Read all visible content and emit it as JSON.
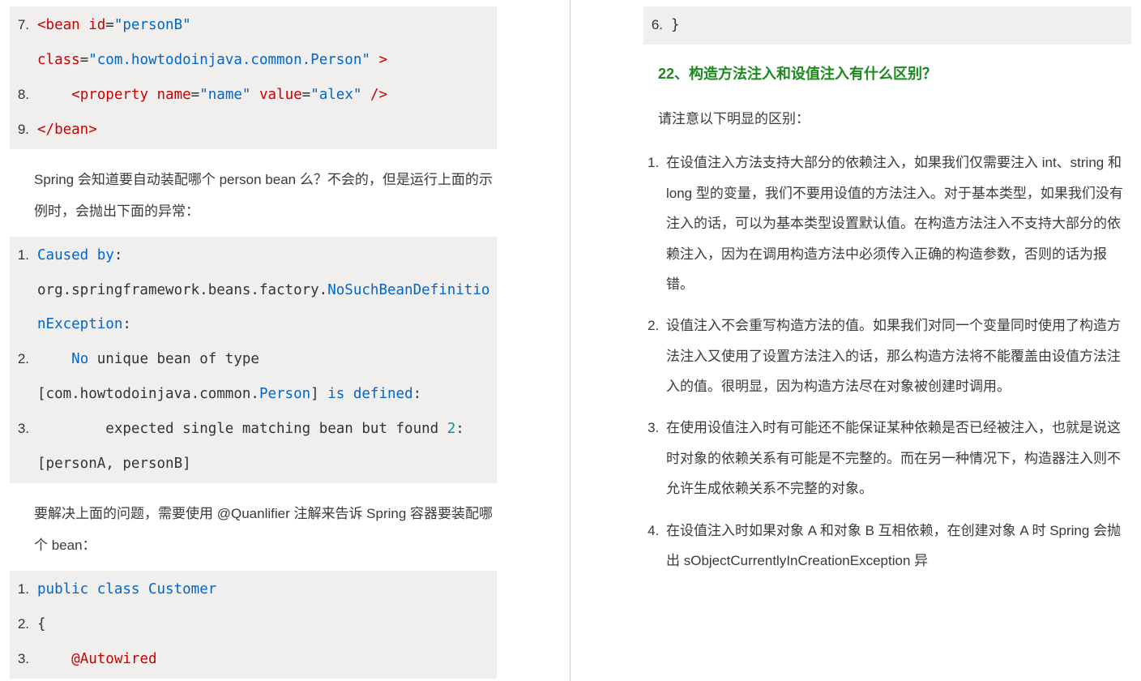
{
  "left": {
    "code_bean": [
      {
        "n": "7.",
        "frags": [
          {
            "t": "<bean ",
            "c": "tk-red"
          },
          {
            "t": "id",
            "c": "tk-red"
          },
          {
            "t": "=",
            "c": "tk-gray"
          },
          {
            "t": "\"personB\"",
            "c": "tk-blue"
          }
        ]
      },
      {
        "n": "",
        "frags": [
          {
            "t": "class",
            "c": "tk-red"
          },
          {
            "t": "=",
            "c": "tk-gray"
          },
          {
            "t": "\"com.howtodoinjava.common.Person\"",
            "c": "tk-blue"
          },
          {
            "t": " >",
            "c": "tk-red"
          }
        ]
      },
      {
        "n": "8.",
        "frags": [
          {
            "t": "    <property ",
            "c": "tk-red"
          },
          {
            "t": "name",
            "c": "tk-red"
          },
          {
            "t": "=",
            "c": "tk-gray"
          },
          {
            "t": "\"name\"",
            "c": "tk-blue"
          },
          {
            "t": " value",
            "c": "tk-red"
          },
          {
            "t": "=",
            "c": "tk-gray"
          },
          {
            "t": "\"alex\"",
            "c": "tk-blue"
          },
          {
            "t": " />",
            "c": "tk-red"
          }
        ]
      },
      {
        "n": "9.",
        "frags": [
          {
            "t": "</bean>",
            "c": "tk-red"
          }
        ]
      }
    ],
    "para1": "Spring 会知道要自动装配哪个 person bean 么？不会的，但是运行上面的示例时，会抛出下面的异常：",
    "code_exc": [
      {
        "n": "1.",
        "frags": [
          {
            "t": "Caused",
            "c": "tk-blue"
          },
          {
            "t": " by",
            "c": "tk-blue"
          },
          {
            "t": ":",
            "c": "tk-gray"
          }
        ]
      },
      {
        "n": "",
        "frags": [
          {
            "t": "org.springframework.beans.factory.",
            "c": "tk-gray"
          },
          {
            "t": "NoSuchBeanDefinitionException",
            "c": "tk-blue"
          },
          {
            "t": ":",
            "c": "tk-gray"
          }
        ]
      },
      {
        "n": "2.",
        "frags": [
          {
            "t": "    ",
            "c": ""
          },
          {
            "t": "No",
            "c": "tk-blue"
          },
          {
            "t": " unique bean of type",
            "c": "tk-gray"
          }
        ]
      },
      {
        "n": "",
        "frags": [
          {
            "t": "[com.howtodoinjava.common.",
            "c": "tk-gray"
          },
          {
            "t": "Person",
            "c": "tk-blue"
          },
          {
            "t": "] ",
            "c": "tk-gray"
          },
          {
            "t": "is",
            "c": "tk-blue"
          },
          {
            "t": " defined",
            "c": "tk-blue"
          },
          {
            "t": ":",
            "c": "tk-gray"
          }
        ]
      },
      {
        "n": "3.",
        "frags": [
          {
            "t": "        expected single matching bean but found ",
            "c": "tk-gray"
          },
          {
            "t": "2",
            "c": "tk-num"
          },
          {
            "t": ":",
            "c": "tk-gray"
          }
        ]
      },
      {
        "n": "",
        "frags": [
          {
            "t": "[personA, personB]",
            "c": "tk-gray"
          }
        ]
      }
    ],
    "para2": "要解决上面的问题，需要使用  @Quanlifier 注解来告诉 Spring 容器要装配哪个 bean：",
    "code_cust": [
      {
        "n": "1.",
        "frags": [
          {
            "t": "public",
            "c": "tk-blue"
          },
          {
            "t": " class",
            "c": "tk-blue"
          },
          {
            "t": " Customer",
            "c": "tk-blue"
          }
        ]
      },
      {
        "n": "2.",
        "frags": [
          {
            "t": "{",
            "c": "tk-gray"
          }
        ]
      },
      {
        "n": "3.",
        "frags": [
          {
            "t": "    @Autowired",
            "c": "tk-red"
          }
        ]
      }
    ]
  },
  "right": {
    "code_close": [
      {
        "n": "6.",
        "frags": [
          {
            "t": "}",
            "c": "tk-gray"
          }
        ]
      }
    ],
    "heading": "22、构造方法注入和设值注入有什么区别？",
    "intro": "请注意以下明显的区别：",
    "items": [
      "在设值注入方法支持大部分的依赖注入，如果我们仅需要注入 int、string 和 long 型的变量，我们不要用设值的方法注入。对于基本类型，如果我们没有注入的话，可以为基本类型设置默认值。在构造方法注入不支持大部分的依赖注入，因为在调用构造方法中必须传入正确的构造参数，否则的话为报错。",
      "设值注入不会重写构造方法的值。如果我们对同一个变量同时使用了构造方法注入又使用了设置方法注入的话，那么构造方法将不能覆盖由设值方法注入的值。很明显，因为构造方法尽在对象被创建时调用。",
      "在使用设值注入时有可能还不能保证某种依赖是否已经被注入，也就是说这时对象的依赖关系有可能是不完整的。而在另一种情况下，构造器注入则不允许生成依赖关系不完整的对象。",
      "在设值注入时如果对象 A 和对象 B 互相依赖，在创建对象 A 时 Spring 会抛出 sObjectCurrentlyInCreationException 异"
    ]
  }
}
